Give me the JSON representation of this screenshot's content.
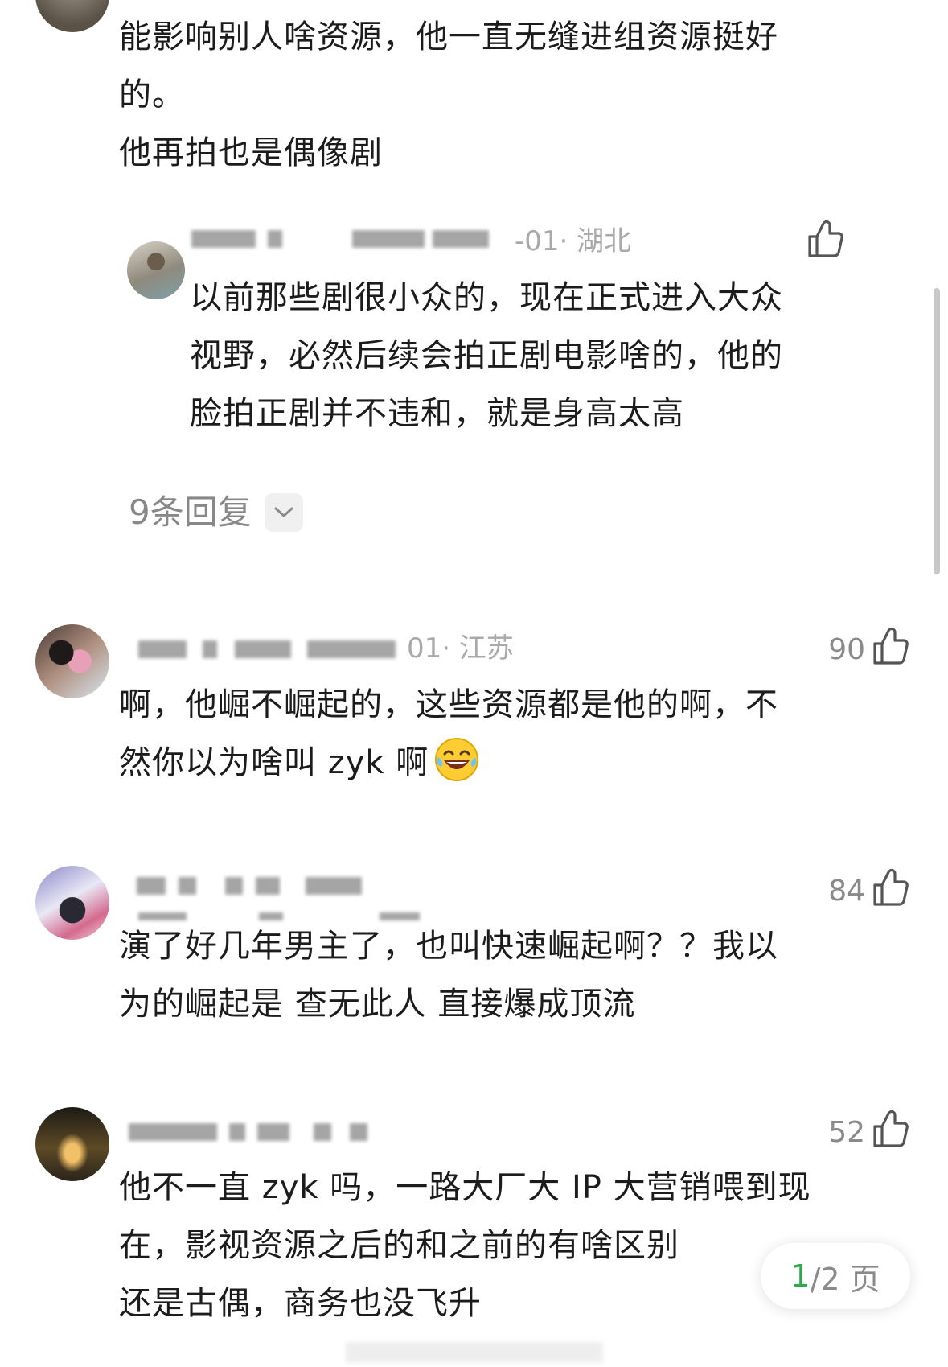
{
  "top_comment": {
    "lines": [
      "能影响别人啥资源，他一直无缝进组资源挺好",
      "的。",
      "他再拍也是偶像剧"
    ]
  },
  "reply": {
    "meta_visible": "-01· 湖北",
    "lines": [
      "以前那些剧很小众的，现在正式进入大众",
      "视野，必然后续会拍正剧电影啥的，他的",
      "脸拍正剧并不违和，就是身高太高"
    ]
  },
  "replies_toggle": {
    "label": "9条回复"
  },
  "comments": [
    {
      "meta_visible": "01· 江苏",
      "likes": "90",
      "lines": [
        "啊，他崛不崛起的，这些资源都是他的啊，不",
        "然你以为啥叫 zyk 啊"
      ]
    },
    {
      "likes": "84",
      "lines": [
        "演了好几年男主了，也叫快速崛起啊？？我以",
        "为的崛起是 查无此人 直接爆成顶流"
      ]
    },
    {
      "likes": "52",
      "lines": [
        "他不一直 zyk 吗，一路大厂大 IP 大营销喂到现",
        "在，影视资源之后的和之前的有啥区别",
        "还是古偶，商务也没飞升"
      ]
    }
  ],
  "pager": {
    "current": "1",
    "rest": "/2 页"
  },
  "colors": {
    "text": "#1c1c1c",
    "meta": "#a9a9a9",
    "count": "#8a8a8a",
    "pager_current": "#2fa84f"
  }
}
